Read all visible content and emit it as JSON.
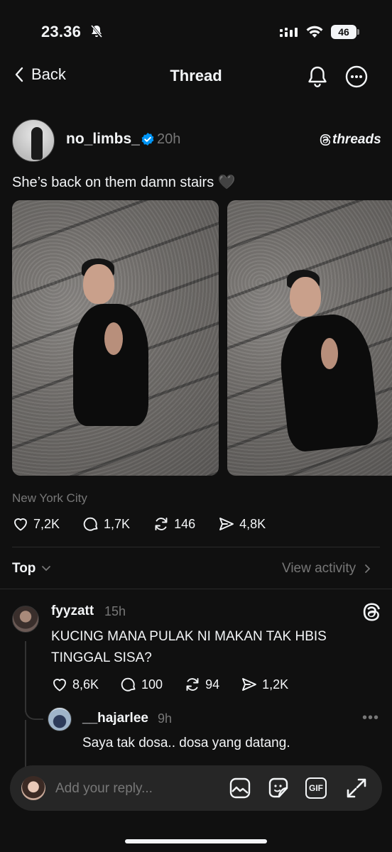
{
  "status_bar": {
    "time": "23.36",
    "battery": "46"
  },
  "nav": {
    "back_label": "Back",
    "title": "Thread"
  },
  "post": {
    "username": "no_limbs_",
    "time": "20h",
    "brand": "threads",
    "text": "She’s back on them damn stairs 🖤",
    "location": "New York City",
    "likes": "7,2K",
    "comments": "1,7K",
    "reposts": "146",
    "shares": "4,8K"
  },
  "sort": {
    "label": "Top",
    "view_activity": "View activity"
  },
  "reply": {
    "username": "fyyzatt",
    "time": "15h",
    "text": "KUCING MANA PULAK NI MAKAN TAK HBIS TINGGAL SISA?",
    "likes": "8,6K",
    "comments": "100",
    "reposts": "94",
    "shares": "1,2K"
  },
  "sub_reply": {
    "username": "__hajarlee",
    "time": "9h",
    "text": "Saya tak dosa.. dosa yang datang."
  },
  "composer": {
    "placeholder": "Add your reply...",
    "gif_label": "GIF"
  },
  "icons": [
    "mute-icon",
    "signal-icon",
    "wifi-icon",
    "back-chevron-icon",
    "bell-icon",
    "more-icon",
    "verified-icon",
    "threads-icon",
    "heart-icon",
    "comment-icon",
    "repost-icon",
    "share-icon",
    "chevron-down-icon",
    "chevron-right-icon",
    "image-icon",
    "sticker-icon",
    "expand-icon"
  ],
  "colors": {
    "background": "#101010",
    "text": "#f3f5f7",
    "secondary": "#777777",
    "verified": "#0095f6"
  }
}
